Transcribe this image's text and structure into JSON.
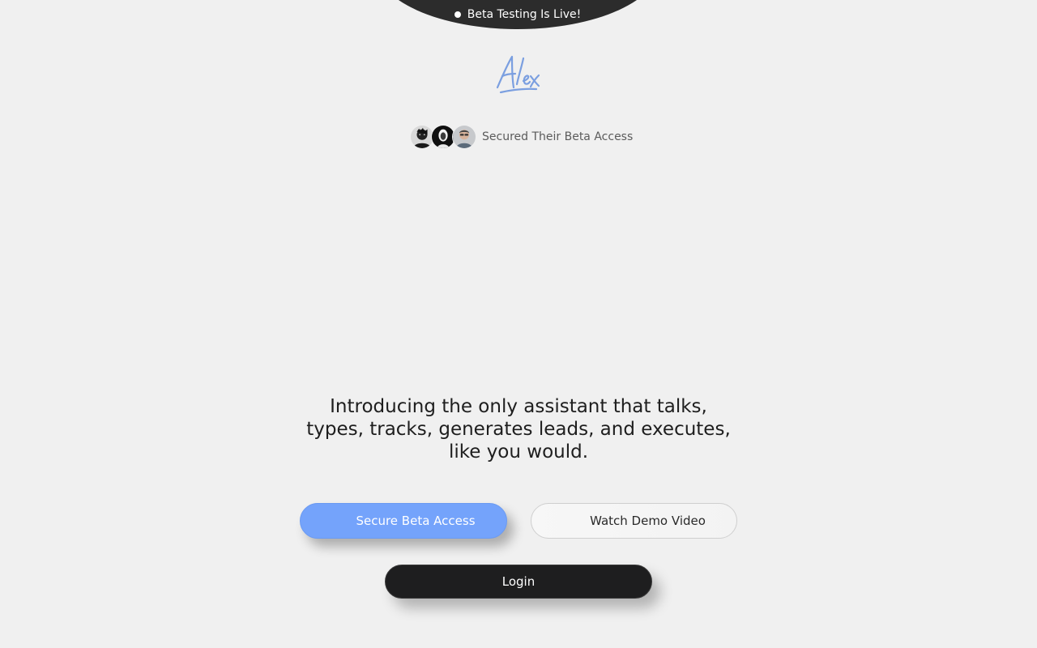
{
  "banner": {
    "text": "Beta Testing Is Live!"
  },
  "logo": {
    "text": "Alex",
    "color": "#7b9fe0"
  },
  "social_proof": {
    "label": "Secured Their Beta Access",
    "avatar_count": 3
  },
  "headline": "Introducing the only assistant that talks, types, tracks, generates leads, and executes, like you would.",
  "buttons": {
    "primary_label": "Secure Beta Access",
    "secondary_label": "Watch Demo Video",
    "login_label": "Login"
  },
  "colors": {
    "background": "#f0f0f0",
    "banner": "#2c2c2c",
    "accent": "#74a3fb",
    "login": "#1e1e1f"
  }
}
